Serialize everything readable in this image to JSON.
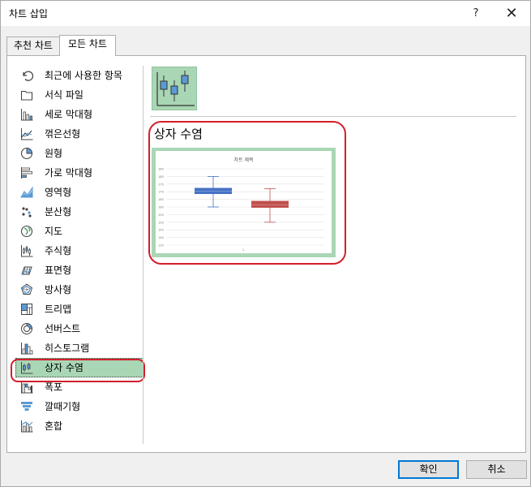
{
  "window": {
    "title": "차트 삽입",
    "help": "?",
    "close": "✕"
  },
  "tabs": [
    {
      "label": "추천 차트",
      "active": false
    },
    {
      "label": "모든 차트",
      "active": true
    }
  ],
  "categories": [
    {
      "label": "최근에 사용한 항목",
      "icon": "recent-icon"
    },
    {
      "label": "서식 파일",
      "icon": "template-folder-icon"
    },
    {
      "label": "세로 막대형",
      "icon": "column-chart-icon"
    },
    {
      "label": "꺾은선형",
      "icon": "line-chart-icon"
    },
    {
      "label": "원형",
      "icon": "pie-chart-icon"
    },
    {
      "label": "가로 막대형",
      "icon": "bar-chart-icon"
    },
    {
      "label": "영역형",
      "icon": "area-chart-icon"
    },
    {
      "label": "분산형",
      "icon": "scatter-chart-icon"
    },
    {
      "label": "지도",
      "icon": "map-chart-icon"
    },
    {
      "label": "주식형",
      "icon": "stock-chart-icon"
    },
    {
      "label": "표면형",
      "icon": "surface-chart-icon"
    },
    {
      "label": "방사형",
      "icon": "radar-chart-icon"
    },
    {
      "label": "트리맵",
      "icon": "treemap-chart-icon"
    },
    {
      "label": "선버스트",
      "icon": "sunburst-chart-icon"
    },
    {
      "label": "히스토그램",
      "icon": "histogram-chart-icon"
    },
    {
      "label": "상자 수염",
      "icon": "box-whisker-chart-icon",
      "selected": true
    },
    {
      "label": "폭포",
      "icon": "waterfall-chart-icon"
    },
    {
      "label": "깔때기형",
      "icon": "funnel-chart-icon"
    },
    {
      "label": "혼합",
      "icon": "combo-chart-icon"
    }
  ],
  "selected_type": {
    "heading": "상자 수염",
    "subtype_icon": "box-whisker-subtype-icon"
  },
  "preview": {
    "title": "차트 제목",
    "footer": "1",
    "y_ticks": [
      "185",
      "180",
      "175",
      "170",
      "165",
      "160",
      "155",
      "150",
      "145",
      "140",
      "135"
    ],
    "colors": {
      "box1": "#4472c4",
      "box2": "#c0504d",
      "border": "#a9d6b5"
    }
  },
  "chart_data": {
    "type": "box",
    "title": "차트 제목",
    "categories": [
      "1"
    ],
    "ylim": [
      135,
      185
    ],
    "y_ticks": [
      135,
      140,
      145,
      150,
      155,
      160,
      165,
      170,
      175,
      180,
      185
    ],
    "series": [
      {
        "min": 160,
        "q1": 168.5,
        "median": 170.5,
        "q3": 172.5,
        "max": 180,
        "color": "#4472c4"
      },
      {
        "min": 150,
        "q1": 159.5,
        "median": 161.5,
        "q3": 164,
        "max": 172,
        "color": "#c0504d"
      }
    ]
  },
  "buttons": {
    "ok": "확인",
    "cancel": "취소"
  }
}
